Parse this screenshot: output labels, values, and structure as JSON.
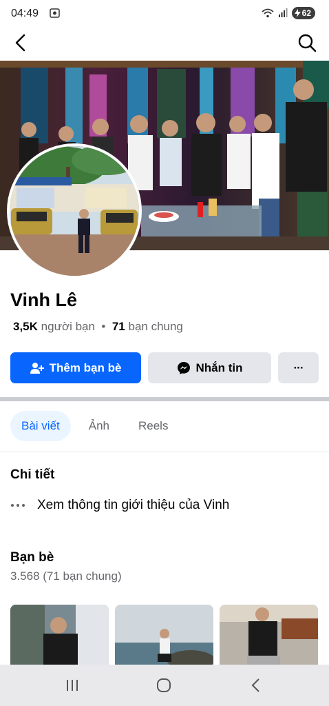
{
  "status": {
    "time": "04:49",
    "battery": "62"
  },
  "profile": {
    "name": "Vinh Lê",
    "friends_count": "3,5K",
    "friends_label": "người bạn",
    "mutual_count": "71",
    "mutual_label": "bạn chung"
  },
  "actions": {
    "add_friend": "Thêm bạn bè",
    "message": "Nhắn tin",
    "more": "···"
  },
  "tabs": [
    {
      "label": "Bài viết",
      "active": true
    },
    {
      "label": "Ảnh",
      "active": false
    },
    {
      "label": "Reels",
      "active": false
    }
  ],
  "details": {
    "title": "Chi tiết",
    "about_link": "Xem thông tin giới thiệu của Vinh"
  },
  "friends": {
    "title": "Bạn bè",
    "count_text": "3.568 (71 bạn chung)"
  },
  "colors": {
    "primary": "#0866ff",
    "secondary_bg": "#e4e6eb",
    "tab_active_bg": "#ebf5ff",
    "muted_text": "#65676b"
  },
  "icons": {
    "back": "arrow-left-icon",
    "search": "search-icon",
    "add_friend": "person-plus-icon",
    "message": "messenger-icon",
    "more": "more-dots-icon"
  }
}
